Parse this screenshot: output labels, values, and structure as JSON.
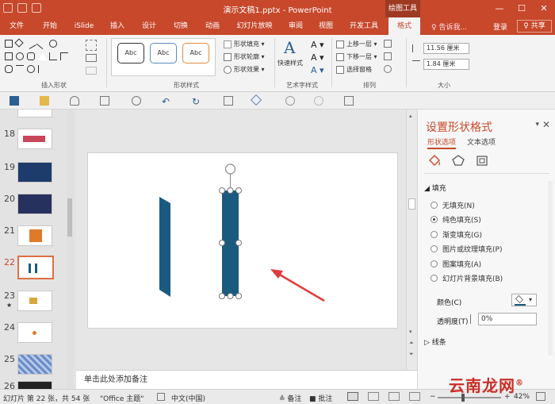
{
  "titlebar": {
    "title": "演示文稿1.pptx - PowerPoint",
    "context_tool": "绘图工具",
    "min": "—",
    "max": "☐",
    "close": "✕"
  },
  "tabs": [
    {
      "label": "文件"
    },
    {
      "label": "开始"
    },
    {
      "label": "iSlide"
    },
    {
      "label": "插入"
    },
    {
      "label": "设计"
    },
    {
      "label": "切换"
    },
    {
      "label": "动画"
    },
    {
      "label": "幻灯片放映"
    },
    {
      "label": "审阅"
    },
    {
      "label": "视图"
    },
    {
      "label": "开发工具"
    },
    {
      "label": "格式"
    }
  ],
  "tellme": "♀ 告诉我...",
  "login": "登录",
  "share": "♀ 共享",
  "ribbon": {
    "insert_shape_label": "插入形状",
    "shape_styles_label": "形状样式",
    "style_sample": "Abc",
    "shape_fill": "形状填充 ▾",
    "shape_outline": "形状轮廓 ▾",
    "shape_effect": "形状效果 ▾",
    "art_text_label": "艺术字样式",
    "quick_style": "快速样式",
    "arrange_label": "排列",
    "bring_forward": "上移一层 ▾",
    "send_backward": "下移一层 ▾",
    "selection_pane": "选择窗格",
    "size_label": "大小",
    "height": "11.56 厘米",
    "width": "1.84 厘米"
  },
  "thumbnails": [
    {
      "num": "18"
    },
    {
      "num": "19"
    },
    {
      "num": "20"
    },
    {
      "num": "21"
    },
    {
      "num": "22",
      "active": true
    },
    {
      "num": "23",
      "star": "★"
    },
    {
      "num": "24"
    },
    {
      "num": "25"
    },
    {
      "num": "26"
    }
  ],
  "notes": "单击此处添加备注",
  "pane": {
    "title": "设置形状格式",
    "tab_shape": "形状选项",
    "tab_text": "文本选项",
    "fill_section": "◢ 填充",
    "fill_options": [
      {
        "label": "无填充(N)",
        "selected": false
      },
      {
        "label": "纯色填充(S)",
        "selected": true
      },
      {
        "label": "渐变填充(G)",
        "selected": false
      },
      {
        "label": "图片或纹理填充(P)",
        "selected": false
      },
      {
        "label": "图案填充(A)",
        "selected": false
      },
      {
        "label": "幻灯片背景填充(B)",
        "selected": false
      }
    ],
    "color_label": "颜色(C)",
    "transparency_label": "透明度(T)",
    "transparency_value": "0%",
    "line_section": "▷ 线条"
  },
  "status": {
    "slide_info": "幻灯片 第 22 张，共 54 张",
    "theme": "\"Office 主题\"",
    "lang": "中文(中国)",
    "notes": "≙ 备注",
    "comments": "■ 批注",
    "zoom": "42%"
  },
  "watermark": {
    "text": "云南龙网",
    "suffix": "®"
  },
  "colors": {
    "accent": "#c7482b",
    "shape_fill": "#1b5a7f",
    "arrow": "#e03a3a"
  }
}
